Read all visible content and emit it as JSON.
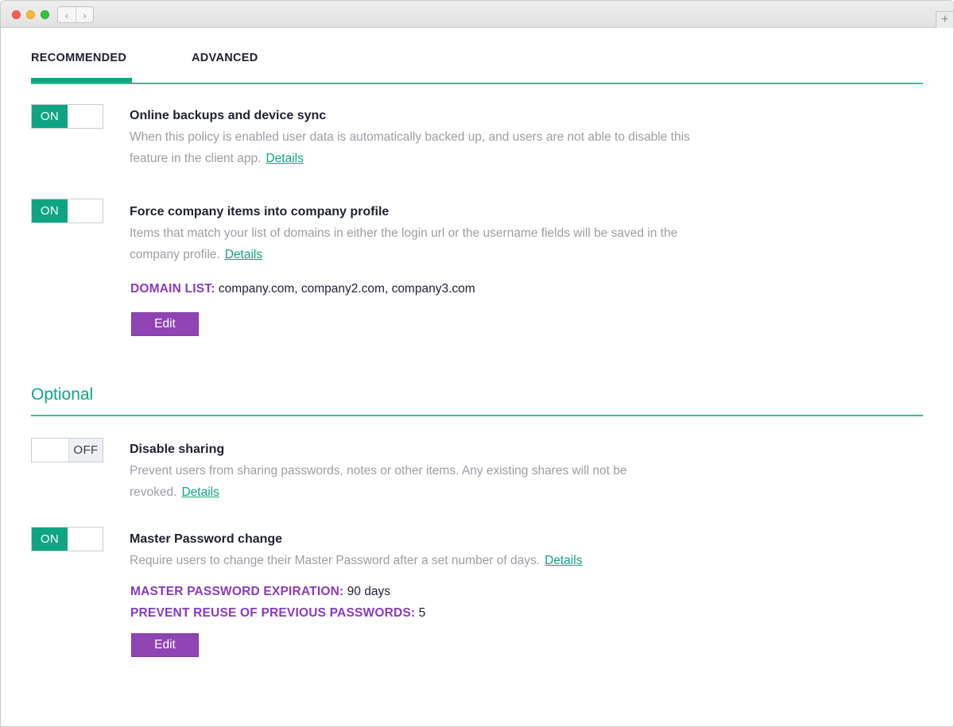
{
  "window": {
    "nav_back": "‹",
    "nav_forward": "›",
    "new_tab": "+"
  },
  "tabs": [
    {
      "label": "RECOMMENDED",
      "active": true
    },
    {
      "label": "ADVANCED",
      "active": false
    }
  ],
  "recommended": {
    "policies": [
      {
        "toggle": "ON",
        "title": "Online backups and device sync",
        "description": "When this policy is enabled user data is automatically backed up, and users are not able to disable this feature in the client app.",
        "details_label": "Details"
      },
      {
        "toggle": "ON",
        "title": "Force company items into company profile",
        "description": "Items that match your list of domains in either the login url or the username fields will be saved in the company profile.",
        "details_label": "Details",
        "settings": [
          {
            "key": "DOMAIN LIST:",
            "value": "company.com, company2.com, company3.com"
          }
        ],
        "edit_label": "Edit"
      }
    ]
  },
  "optional": {
    "section_title": "Optional",
    "policies": [
      {
        "toggle": "OFF",
        "title": "Disable sharing",
        "description": "Prevent users from sharing passwords, notes or other items. Any existing shares will not be revoked.",
        "details_label": "Details"
      },
      {
        "toggle": "ON",
        "title": "Master Password change",
        "description": "Require users to change their Master Password after a set number of days.",
        "details_label": "Details",
        "settings": [
          {
            "key": "MASTER PASSWORD EXPIRATION:",
            "value": "90 days"
          },
          {
            "key": "PREVENT REUSE OF PREVIOUS PASSWORDS:",
            "value": "5"
          }
        ],
        "edit_label": "Edit"
      }
    ]
  },
  "colors": {
    "accent_green": "#0fa582",
    "accent_purple": "#8e44b3"
  }
}
